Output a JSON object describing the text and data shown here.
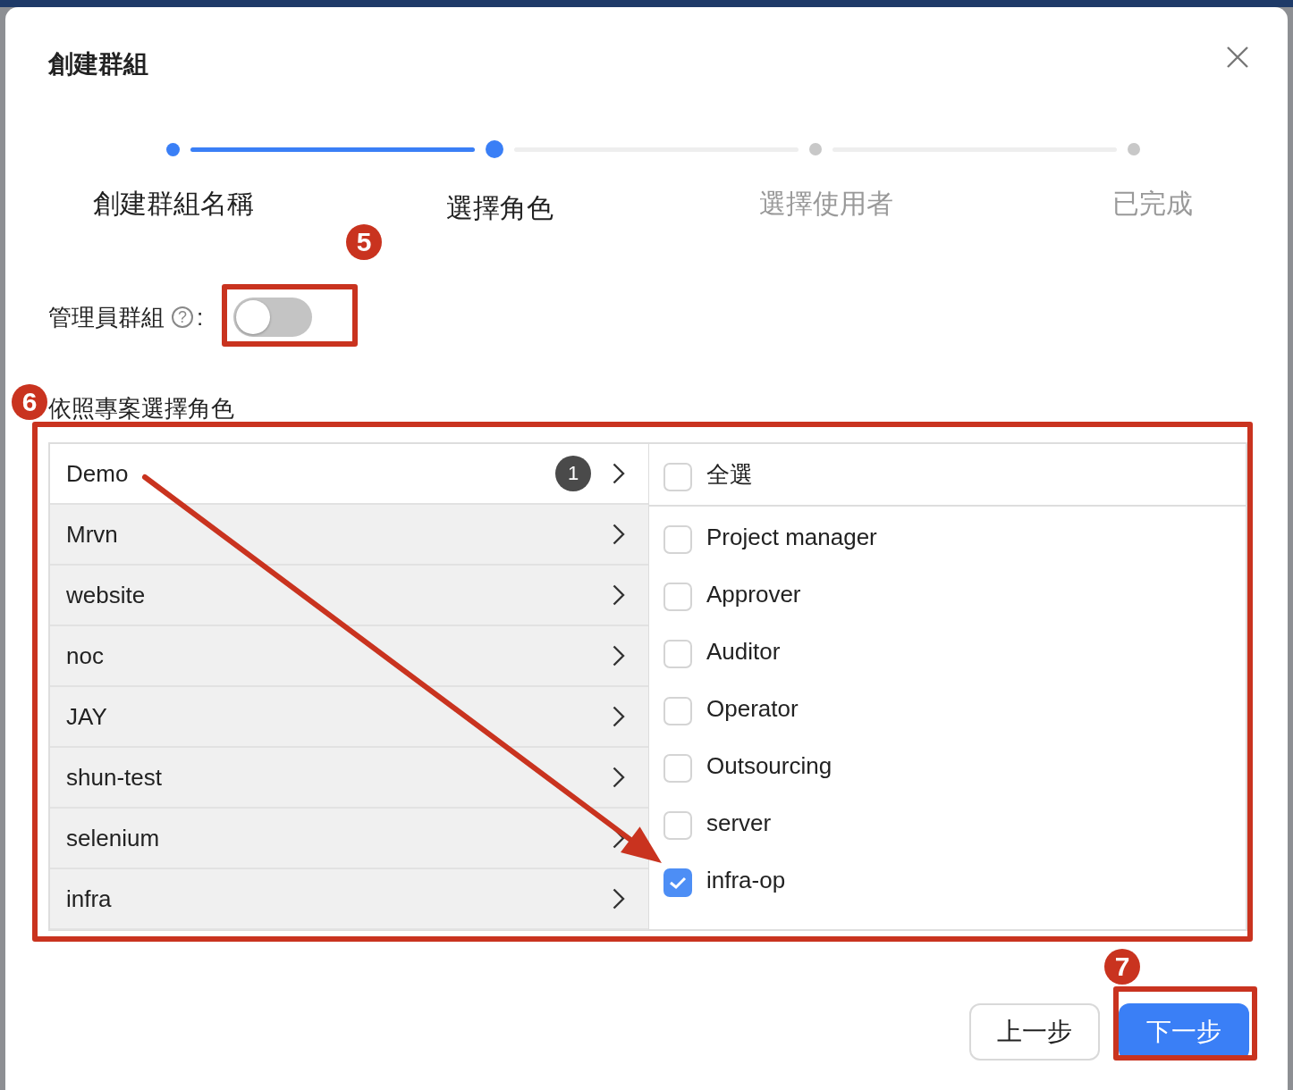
{
  "dialog": {
    "title": "創建群組"
  },
  "steps": [
    {
      "label": "創建群組名稱",
      "done": true,
      "selected": false
    },
    {
      "label": "選擇角色",
      "done": false,
      "selected": true
    },
    {
      "label": "選擇使用者",
      "done": false,
      "selected": false
    },
    {
      "label": "已完成",
      "done": false,
      "selected": false
    }
  ],
  "admin_group": {
    "label": "管理員群組",
    "help": "?",
    "separator": ":",
    "on": false
  },
  "section_label": "依照專案選擇角色",
  "projects": [
    {
      "name": "Demo",
      "selected": true,
      "count": "1"
    },
    {
      "name": "Mrvn",
      "selected": false
    },
    {
      "name": "website",
      "selected": false
    },
    {
      "name": "noc",
      "selected": false
    },
    {
      "name": "JAY",
      "selected": false
    },
    {
      "name": "shun-test",
      "selected": false
    },
    {
      "name": "selenium",
      "selected": false
    },
    {
      "name": "infra",
      "selected": false
    }
  ],
  "select_all": {
    "label": "全選",
    "checked": false
  },
  "roles": [
    {
      "label": "Project manager",
      "checked": false
    },
    {
      "label": "Approver",
      "checked": false
    },
    {
      "label": "Auditor",
      "checked": false
    },
    {
      "label": "Operator",
      "checked": false
    },
    {
      "label": "Outsourcing",
      "checked": false
    },
    {
      "label": "server",
      "checked": false
    },
    {
      "label": "infra-op",
      "checked": true
    }
  ],
  "buttons": [
    {
      "label": "上一步",
      "kind": "default"
    },
    {
      "label": "下一步",
      "kind": "primary"
    }
  ],
  "annotations": [
    {
      "kind": "marker",
      "label": "5"
    },
    {
      "kind": "box"
    },
    {
      "kind": "marker",
      "label": "6"
    },
    {
      "kind": "box"
    },
    {
      "kind": "arrow"
    },
    {
      "kind": "marker",
      "label": "7"
    },
    {
      "kind": "box"
    }
  ]
}
